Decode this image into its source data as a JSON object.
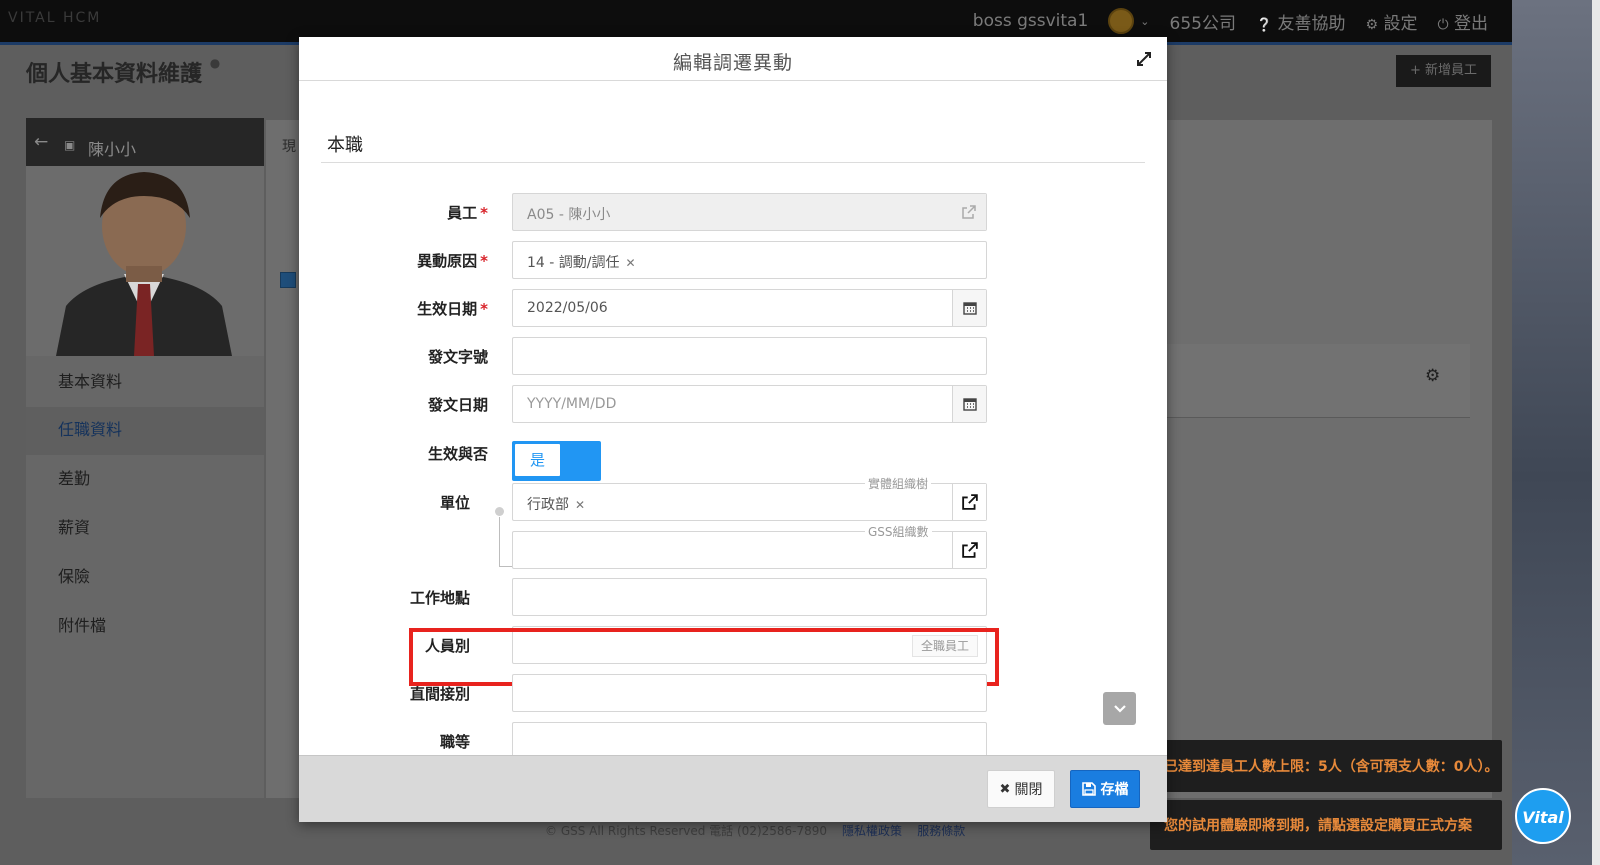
{
  "app": {
    "brand": "VITAL HCM",
    "user_name": "boss gssvita1",
    "company": "655公司",
    "help_label": "友善協助",
    "settings_label": "設定",
    "logout_label": "登出",
    "page_title": "個人基本資料維護",
    "new_employee_label": "新增員工"
  },
  "sidebar": {
    "employee_name": "陳小小",
    "tab_prefix": "現",
    "items": [
      {
        "label": "基本資料"
      },
      {
        "label": "任職資料"
      },
      {
        "label": "差勤"
      },
      {
        "label": "薪資"
      },
      {
        "label": "保險"
      },
      {
        "label": "附件檔"
      }
    ],
    "active_index": 1
  },
  "footer": {
    "copyright": "© GSS All Rights Reserved  電話 (02)2586-7890",
    "privacy_label": "隱私權政策",
    "terms_label": "服務條款"
  },
  "toasts": [
    {
      "text": "已達到達員工人數上限：5人（含可預支人數：0人）。"
    },
    {
      "text": "您的試用體驗即將到期，請點選設定購買正式方案"
    }
  ],
  "badge": {
    "label": "Vital"
  },
  "modal": {
    "title": "編輯調遷異動",
    "section_title": "本職",
    "fields": {
      "employee": {
        "label": "員工",
        "value": "A05 - 陳小小",
        "required": true
      },
      "reason": {
        "label": "異動原因",
        "value": "14 - 調動/調任",
        "required": true
      },
      "effective_date": {
        "label": "生效日期",
        "value": "2022/05/06",
        "required": true
      },
      "doc_number": {
        "label": "發文字號",
        "value": ""
      },
      "doc_date": {
        "label": "發文日期",
        "placeholder": "YYYY/MM/DD"
      },
      "active": {
        "label": "生效與否",
        "value": "是"
      },
      "unit": {
        "label": "單位",
        "value": "行政部",
        "caption_entity": "實體組織樹",
        "caption_gss": "GSS組織數"
      },
      "work_location": {
        "label": "工作地點",
        "value": ""
      },
      "employee_type": {
        "label": "人員別",
        "value": "",
        "hint": "全職員工"
      },
      "direct_indirect": {
        "label": "直間接別",
        "value": ""
      },
      "position": {
        "label": "職等"
      }
    },
    "buttons": {
      "close_label": "關閉",
      "save_label": "存檔"
    }
  },
  "colors": {
    "primary": "#1a7de0",
    "toggle": "#2196f3",
    "required": "#d8232a",
    "highlight": "#e8231e",
    "toast_text": "#e7893a"
  }
}
